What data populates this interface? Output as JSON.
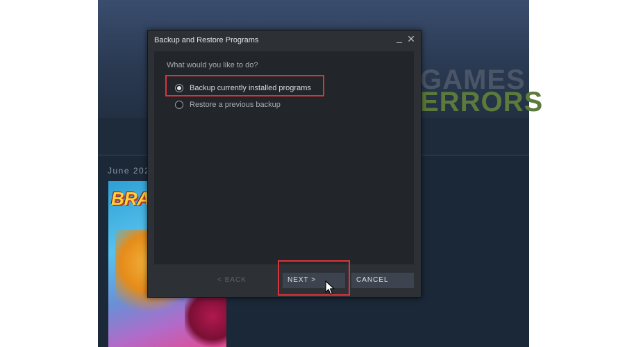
{
  "background_app": {
    "section_date": "June 202",
    "game_logo": "BRA",
    "watermark": {
      "line1": "GAMES",
      "line2": "ERRORS"
    }
  },
  "dialog": {
    "title": "Backup and Restore Programs",
    "minimize_glyph": "_",
    "close_glyph": "✕",
    "prompt": "What would you like to do?",
    "options": [
      {
        "label": "Backup currently installed programs",
        "selected": true
      },
      {
        "label": "Restore a previous backup",
        "selected": false
      }
    ],
    "buttons": {
      "back": "< BACK",
      "next": "NEXT >",
      "cancel": "CANCEL"
    }
  },
  "colors": {
    "highlight": "#d8353a",
    "dialog_bg": "#2d3136",
    "button_bg": "#3d4450"
  }
}
